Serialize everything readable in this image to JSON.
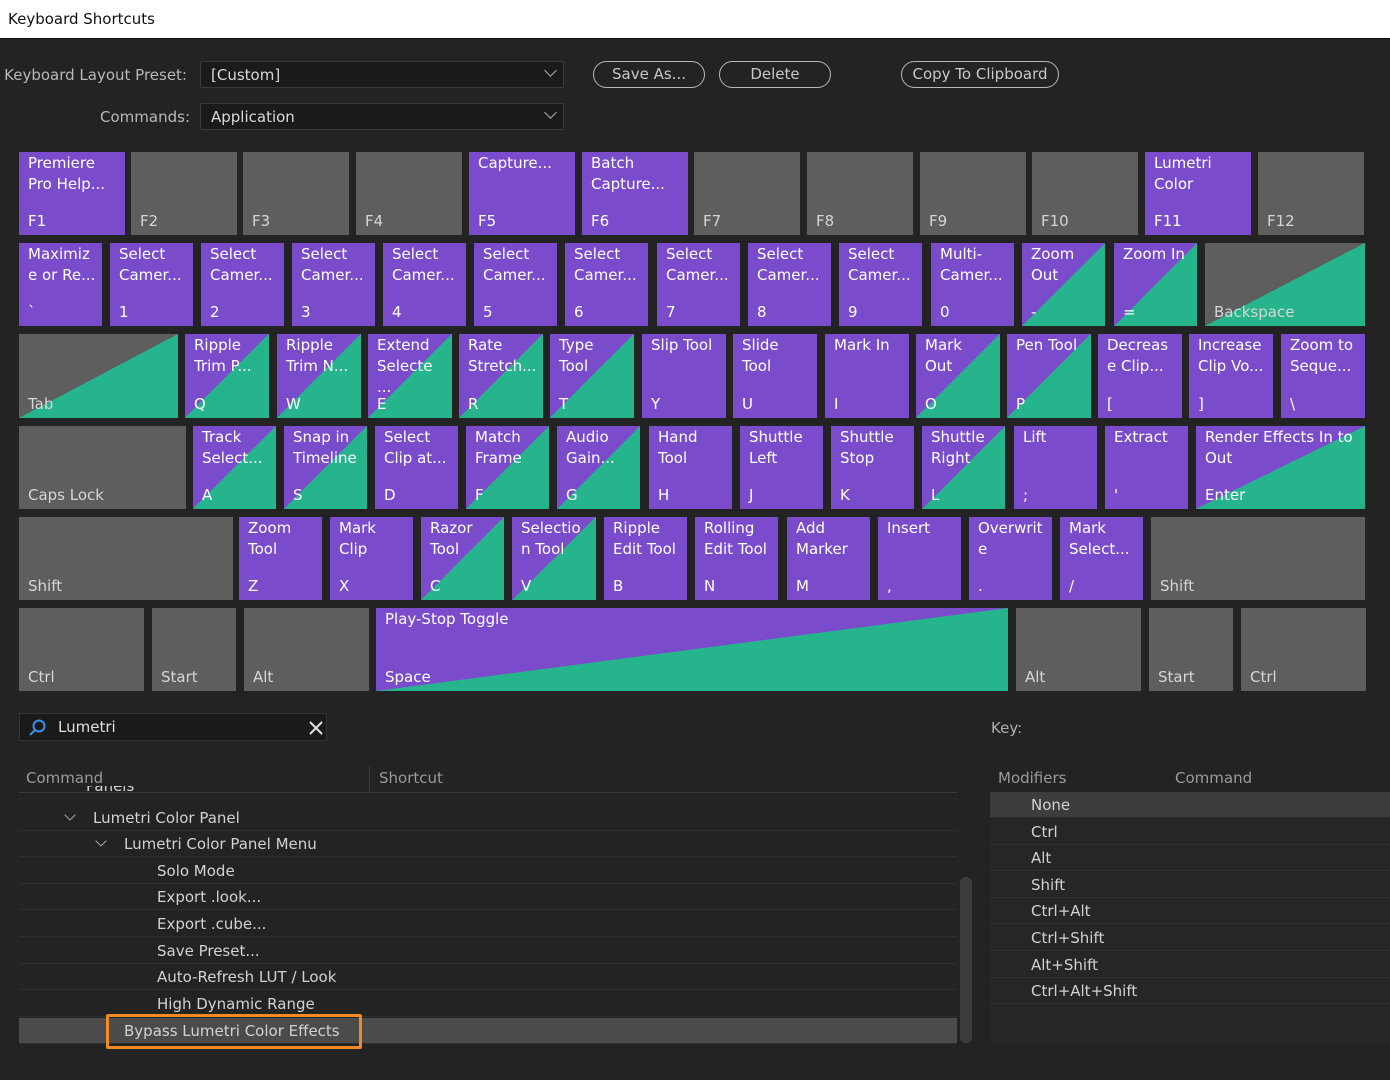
{
  "window": {
    "title": "Keyboard Shortcuts"
  },
  "top": {
    "preset_label": "Keyboard Layout Preset:",
    "preset_value": "[Custom]",
    "commands_label": "Commands:",
    "commands_value": "Application",
    "save_as": "Save As...",
    "delete": "Delete",
    "copy": "Copy To Clipboard"
  },
  "keys": [
    {
      "cmd": "Premiere\nPro Help...",
      "key": "F1",
      "state": "assigned"
    },
    {
      "cmd": "",
      "key": "F2",
      "state": "empty"
    },
    {
      "cmd": "",
      "key": "F3",
      "state": "empty"
    },
    {
      "cmd": "",
      "key": "F4",
      "state": "empty"
    },
    {
      "cmd": "Capture...",
      "key": "F5",
      "state": "assigned"
    },
    {
      "cmd": "Batch\nCapture...",
      "key": "F6",
      "state": "assigned"
    },
    {
      "cmd": "",
      "key": "F7",
      "state": "empty"
    },
    {
      "cmd": "",
      "key": "F8",
      "state": "empty"
    },
    {
      "cmd": "",
      "key": "F9",
      "state": "empty"
    },
    {
      "cmd": "",
      "key": "F10",
      "state": "empty"
    },
    {
      "cmd": "Lumetri\nColor",
      "key": "F11",
      "state": "assigned"
    },
    {
      "cmd": "",
      "key": "F12",
      "state": "empty"
    },
    {
      "cmd": "Maximiz\ne or Re...",
      "key": "`",
      "state": "assigned"
    },
    {
      "cmd": "Select\nCamer...",
      "key": "1",
      "state": "assigned"
    },
    {
      "cmd": "Select\nCamer...",
      "key": "2",
      "state": "assigned"
    },
    {
      "cmd": "Select\nCamer...",
      "key": "3",
      "state": "assigned"
    },
    {
      "cmd": "Select\nCamer...",
      "key": "4",
      "state": "assigned"
    },
    {
      "cmd": "Select\nCamer...",
      "key": "5",
      "state": "assigned"
    },
    {
      "cmd": "Select\nCamer...",
      "key": "6",
      "state": "assigned"
    },
    {
      "cmd": "Select\nCamer...",
      "key": "7",
      "state": "assigned"
    },
    {
      "cmd": "Select\nCamer...",
      "key": "8",
      "state": "assigned"
    },
    {
      "cmd": "Select\nCamer...",
      "key": "9",
      "state": "assigned"
    },
    {
      "cmd": "Multi-\nCamer...",
      "key": "0",
      "state": "assigned"
    },
    {
      "cmd": "Zoom\nOut",
      "key": "-",
      "state": "split"
    },
    {
      "cmd": "Zoom In",
      "key": "=",
      "state": "split"
    },
    {
      "cmd": "",
      "key": "Backspace",
      "state": "graysplit"
    },
    {
      "cmd": "",
      "key": "Tab",
      "state": "graysplit"
    },
    {
      "cmd": "Ripple\nTrim P...",
      "key": "Q",
      "state": "split"
    },
    {
      "cmd": "Ripple\nTrim N...",
      "key": "W",
      "state": "split"
    },
    {
      "cmd": "Extend\nSelecte\n...",
      "key": "E",
      "state": "split"
    },
    {
      "cmd": "Rate\nStretch...",
      "key": "R",
      "state": "split"
    },
    {
      "cmd": "Type\nTool",
      "key": "T",
      "state": "split"
    },
    {
      "cmd": "Slip Tool",
      "key": "Y",
      "state": "assigned"
    },
    {
      "cmd": "Slide\nTool",
      "key": "U",
      "state": "assigned"
    },
    {
      "cmd": "Mark In",
      "key": "I",
      "state": "assigned"
    },
    {
      "cmd": "Mark\nOut",
      "key": "O",
      "state": "split"
    },
    {
      "cmd": "Pen Tool",
      "key": "P",
      "state": "split"
    },
    {
      "cmd": "Decreas\ne Clip...",
      "key": "[",
      "state": "assigned"
    },
    {
      "cmd": "Increase\nClip Vo...",
      "key": "]",
      "state": "assigned"
    },
    {
      "cmd": "Zoom to\nSeque...",
      "key": "\\",
      "state": "assigned"
    },
    {
      "cmd": "",
      "key": "Caps Lock",
      "state": "empty"
    },
    {
      "cmd": "Track\nSelect...",
      "key": "A",
      "state": "split"
    },
    {
      "cmd": "Snap in\nTimeline",
      "key": "S",
      "state": "split"
    },
    {
      "cmd": "Select\nClip at...",
      "key": "D",
      "state": "assigned"
    },
    {
      "cmd": "Match\nFrame",
      "key": "F",
      "state": "split"
    },
    {
      "cmd": "Audio\nGain...",
      "key": "G",
      "state": "split"
    },
    {
      "cmd": "Hand\nTool",
      "key": "H",
      "state": "assigned"
    },
    {
      "cmd": "Shuttle\nLeft",
      "key": "J",
      "state": "assigned"
    },
    {
      "cmd": "Shuttle\nStop",
      "key": "K",
      "state": "assigned"
    },
    {
      "cmd": "Shuttle\nRight",
      "key": "L",
      "state": "split"
    },
    {
      "cmd": "Lift",
      "key": ";",
      "state": "assigned"
    },
    {
      "cmd": "Extract",
      "key": "'",
      "state": "assigned"
    },
    {
      "cmd": "Render Effects In to\nOut",
      "key": "Enter",
      "state": "split"
    },
    {
      "cmd": "",
      "key": "Shift",
      "state": "empty"
    },
    {
      "cmd": "Zoom\nTool",
      "key": "Z",
      "state": "assigned"
    },
    {
      "cmd": "Mark\nClip",
      "key": "X",
      "state": "assigned"
    },
    {
      "cmd": "Razor\nTool",
      "key": "C",
      "state": "split"
    },
    {
      "cmd": "Selectio\nn Tool",
      "key": "V",
      "state": "split"
    },
    {
      "cmd": "Ripple\nEdit Tool",
      "key": "B",
      "state": "assigned"
    },
    {
      "cmd": "Rolling\nEdit Tool",
      "key": "N",
      "state": "assigned"
    },
    {
      "cmd": "Add\nMarker",
      "key": "M",
      "state": "assigned"
    },
    {
      "cmd": "Insert",
      "key": ",",
      "state": "assigned"
    },
    {
      "cmd": "Overwrit\ne",
      "key": ".",
      "state": "assigned"
    },
    {
      "cmd": "Mark\nSelect...",
      "key": "/",
      "state": "assigned"
    },
    {
      "cmd": "",
      "key": "Shift",
      "state": "empty"
    },
    {
      "cmd": "",
      "key": "Ctrl",
      "state": "empty"
    },
    {
      "cmd": "",
      "key": "Start",
      "state": "empty"
    },
    {
      "cmd": "",
      "key": "Alt",
      "state": "empty"
    },
    {
      "cmd": "Play-Stop Toggle",
      "key": "Space",
      "state": "space"
    },
    {
      "cmd": "",
      "key": "Alt",
      "state": "empty"
    },
    {
      "cmd": "",
      "key": "Start",
      "state": "empty"
    },
    {
      "cmd": "",
      "key": "Ctrl",
      "state": "empty"
    }
  ],
  "search": {
    "value": "Lumetri"
  },
  "list": {
    "header_command": "Command",
    "header_shortcut": "Shortcut",
    "rows": [
      {
        "text": "Panels",
        "level": 0,
        "partial": true
      },
      {
        "text": "Lumetri Color Panel",
        "level": 1,
        "expanded": true
      },
      {
        "text": "Lumetri Color Panel Menu",
        "level": 2,
        "expanded": true
      },
      {
        "text": "Solo Mode",
        "level": 3
      },
      {
        "text": "Export .look...",
        "level": 3
      },
      {
        "text": "Export .cube...",
        "level": 3
      },
      {
        "text": "Save Preset...",
        "level": 3
      },
      {
        "text": "Auto-Refresh LUT / Look",
        "level": 3
      },
      {
        "text": "High Dynamic Range",
        "level": 3
      },
      {
        "text": "Bypass Lumetri Color Effects",
        "level": 2,
        "selected": true
      }
    ]
  },
  "key_panel": {
    "title": "Key:",
    "header_modifiers": "Modifiers",
    "header_command": "Command",
    "modifiers": [
      "None",
      "Ctrl",
      "Alt",
      "Shift",
      "Ctrl+Alt",
      "Ctrl+Shift",
      "Alt+Shift",
      "Ctrl+Alt+Shift"
    ]
  },
  "colors": {
    "assigned": "#7a4ccc",
    "modifier": "#25b48c",
    "empty": "#5e5e5e",
    "highlight": "#f08a24"
  }
}
